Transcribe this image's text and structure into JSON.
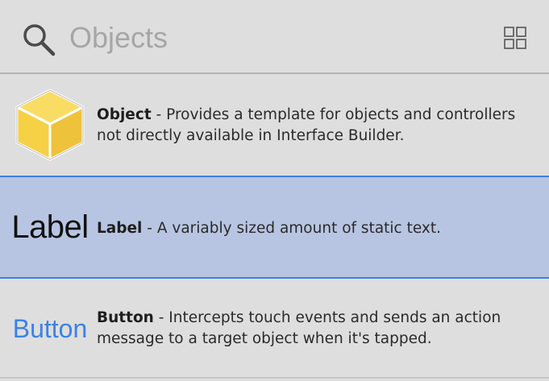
{
  "search": {
    "placeholder": "Objects",
    "icon": "search-icon",
    "view_toggle_icon": "grid-icon"
  },
  "items": [
    {
      "preview_icon": "cube-icon",
      "title": "Object",
      "separator": " - ",
      "description": "Provides a template for objects and controllers not directly available in Interface Builder.",
      "selected": false
    },
    {
      "preview_text": "Label",
      "title": "Label",
      "separator": " - ",
      "description": "A variably sized amount of static text.",
      "selected": true
    },
    {
      "preview_text": "Button",
      "title": "Button",
      "separator": " - ",
      "description": "Intercepts touch events and sends an action message to a target object when it's tapped.",
      "selected": false
    }
  ],
  "colors": {
    "background": "#dedede",
    "selection_fill": "#b8c5e2",
    "selection_border": "#3f7fe0",
    "button_preview_text": "#3b82e6",
    "cube_face": "#f6d045"
  }
}
